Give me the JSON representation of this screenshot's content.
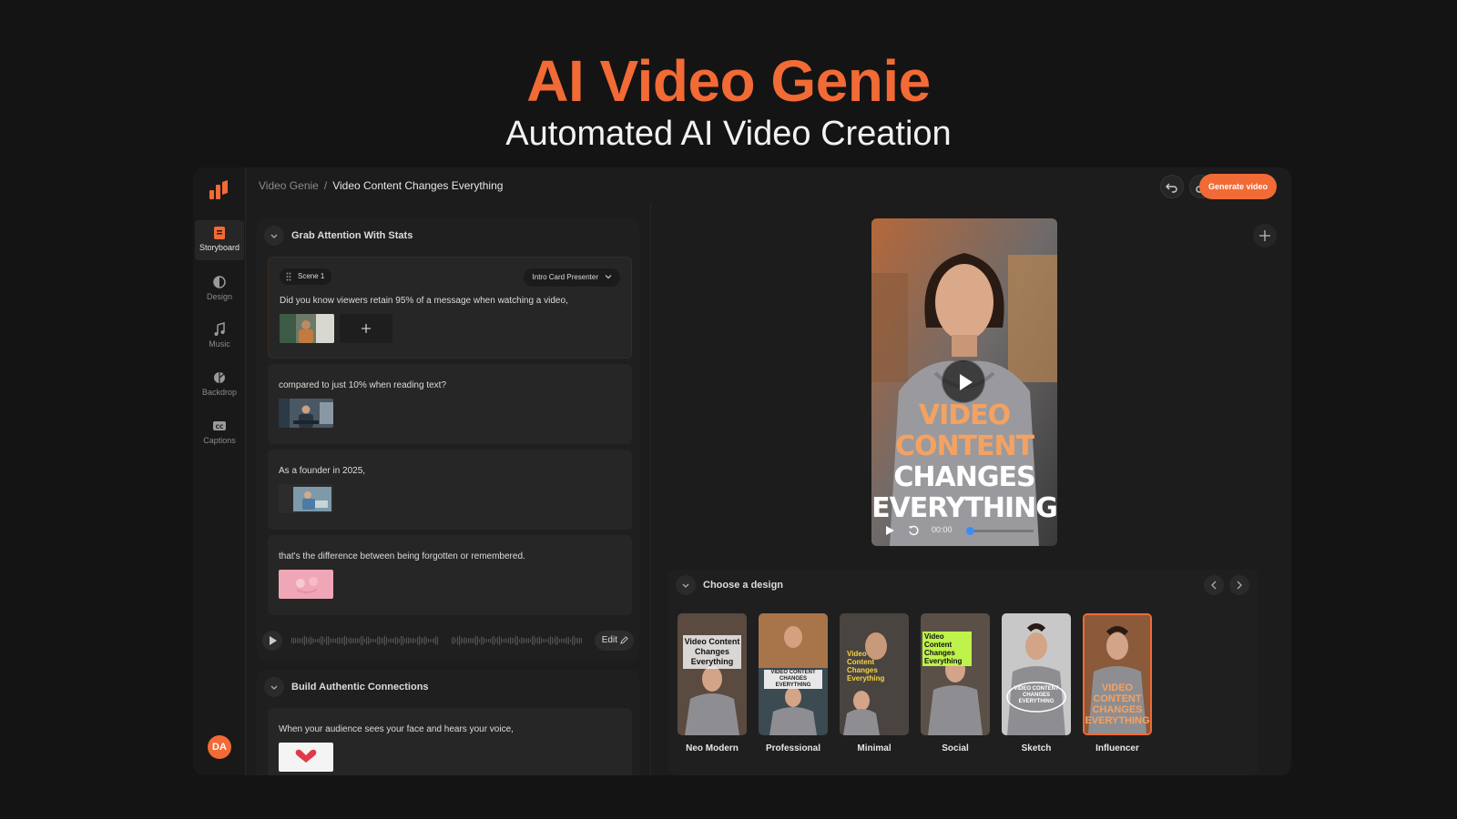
{
  "hero": {
    "title": "AI Video Genie",
    "subtitle": "Automated AI Video Creation"
  },
  "sidebar": {
    "items": [
      {
        "label": "Storyboard",
        "icon": "storyboard-icon"
      },
      {
        "label": "Design",
        "icon": "design-icon"
      },
      {
        "label": "Music",
        "icon": "music-icon"
      },
      {
        "label": "Backdrop",
        "icon": "backdrop-icon"
      },
      {
        "label": "Captions",
        "icon": "captions-icon"
      }
    ],
    "active": "Storyboard",
    "avatar": "DA"
  },
  "topbar": {
    "breadcrumb_root": "Video Genie",
    "breadcrumb_sep": "/",
    "breadcrumb_current": "Video Content Changes Everything",
    "generate_label": "Generate video"
  },
  "storyboard": {
    "sections": [
      {
        "title": "Grab Attention With Stats",
        "scenes": [
          {
            "tag": "Scene 1",
            "presenter": "Intro Card Presenter",
            "text": "Did you know viewers retain 95% of a message when watching a video,"
          },
          {
            "text": "compared to just 10% when reading text?"
          },
          {
            "text": "As a founder in 2025,"
          },
          {
            "text": "that's the difference between being forgotten or remembered."
          }
        ],
        "audio_edit_label": "Edit"
      },
      {
        "title": "Build Authentic Connections",
        "scenes": [
          {
            "text": "When your audience sees your face and hears your voice,"
          }
        ]
      }
    ]
  },
  "preview": {
    "caption_lines": [
      "VIDEO CONTENT",
      "CHANGES",
      "EVERYTHING"
    ],
    "time": "00:00",
    "progress": 0.02
  },
  "designs": {
    "title": "Choose a design",
    "items": [
      {
        "name": "Neo Modern",
        "caption": "Video Content Changes Everything"
      },
      {
        "name": "Professional",
        "caption": "VIDEO CONTENT CHANGES EVERYTHING"
      },
      {
        "name": "Minimal",
        "caption": "Video Content Changes Everything"
      },
      {
        "name": "Social",
        "caption": "Video Content Changes Everything"
      },
      {
        "name": "Sketch",
        "caption": "VIDEO CONTENT CHANGES EVERYTHING"
      },
      {
        "name": "Influencer",
        "caption": "VIDEO CONTENT CHANGES EVERYTHING"
      }
    ],
    "selected": "Influencer"
  },
  "colors": {
    "accent": "#f26a35",
    "background": "#141414",
    "panel": "#1f1f1f",
    "progress": "#3b8df5"
  }
}
